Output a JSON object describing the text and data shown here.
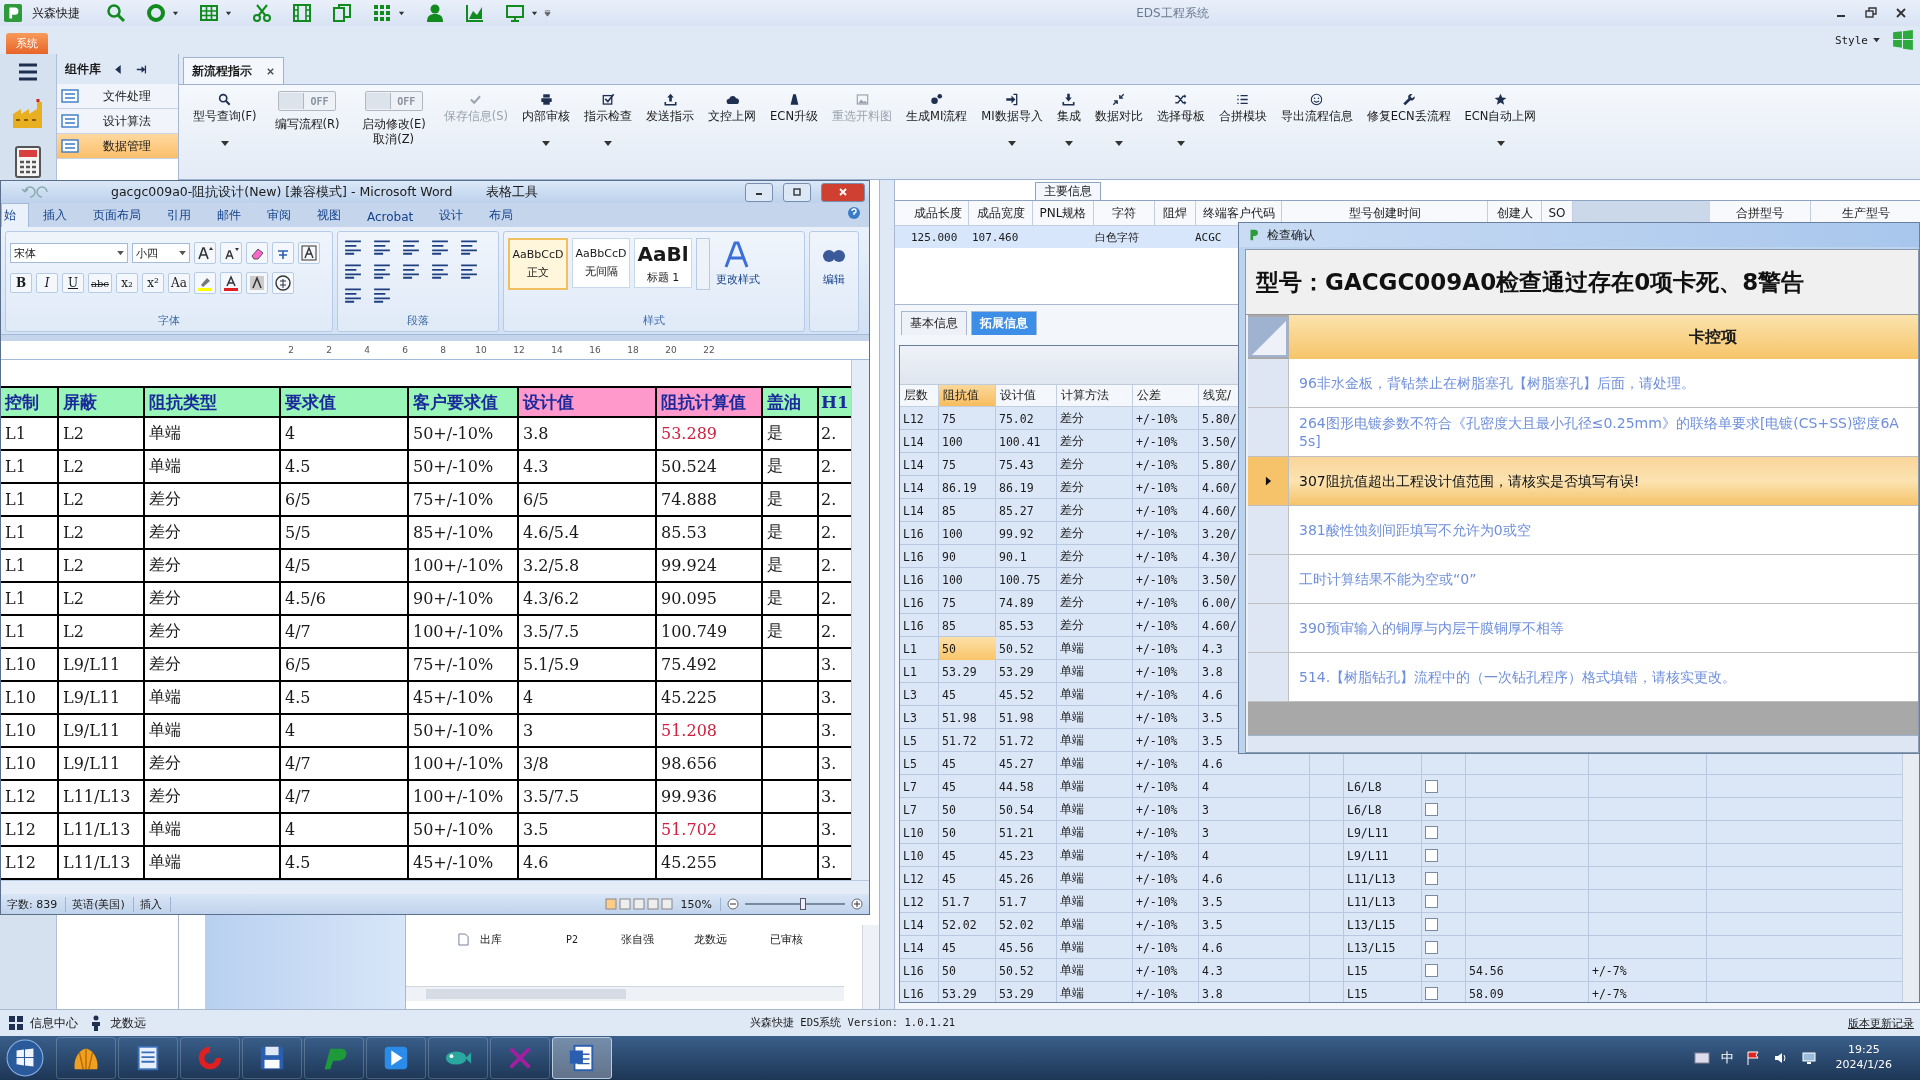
{
  "app": {
    "brand": "兴森快捷",
    "title": "EDS工程系统",
    "style_label": "Style"
  },
  "menu_tabs": [
    {
      "label": "系统",
      "selected": true
    }
  ],
  "sidebar": {
    "title": "组件库",
    "items": [
      {
        "label": "文件处理",
        "selected": false
      },
      {
        "label": "设计算法",
        "selected": false
      },
      {
        "label": "数据管理",
        "selected": true
      }
    ]
  },
  "doc_tabs": [
    {
      "label": "新流程指示",
      "selected": true
    }
  ],
  "toolbar": [
    {
      "kind": "button",
      "label": "型号查询(F)",
      "dropdown": true,
      "disabled": false
    },
    {
      "kind": "toggle",
      "label": "编写流程(R)",
      "switch_text": "OFF",
      "on": false
    },
    {
      "kind": "toggle",
      "label": "启动修改(E)\n取消(Z)",
      "switch_text": "OFF",
      "on": false
    },
    {
      "kind": "button",
      "label": "保存信息(S)",
      "dropdown": false,
      "disabled": true
    },
    {
      "kind": "button",
      "label": "内部审核",
      "dropdown": true,
      "disabled": false
    },
    {
      "kind": "button",
      "label": "指示检查",
      "dropdown": true,
      "disabled": false
    },
    {
      "kind": "button",
      "label": "发送指示",
      "dropdown": false,
      "disabled": false
    },
    {
      "kind": "button",
      "label": "文控上网",
      "dropdown": false,
      "disabled": false
    },
    {
      "kind": "button",
      "label": "ECN升级",
      "dropdown": false,
      "disabled": false
    },
    {
      "kind": "button",
      "label": "重选开料图",
      "dropdown": false,
      "disabled": true
    },
    {
      "kind": "button",
      "label": "生成MI流程",
      "dropdown": false,
      "disabled": false
    },
    {
      "kind": "button",
      "label": "MI数据导入",
      "dropdown": true,
      "disabled": false
    },
    {
      "kind": "button",
      "label": "集成",
      "dropdown": true,
      "disabled": false
    },
    {
      "kind": "button",
      "label": "数据对比",
      "dropdown": true,
      "disabled": false
    },
    {
      "kind": "button",
      "label": "选择母板",
      "dropdown": true,
      "disabled": false
    },
    {
      "kind": "button",
      "label": "合拼模块",
      "dropdown": false,
      "disabled": false
    },
    {
      "kind": "button",
      "label": "导出流程信息",
      "dropdown": false,
      "disabled": false
    },
    {
      "kind": "button",
      "label": "修复ECN丢流程",
      "dropdown": false,
      "disabled": false
    },
    {
      "kind": "button",
      "label": "ECN自动上网",
      "dropdown": true,
      "disabled": false
    }
  ],
  "info": {
    "legend": "主要信息",
    "columns": [
      {
        "label": "成品长度",
        "value": "125.000"
      },
      {
        "label": "成品宽度",
        "value": "107.460"
      },
      {
        "label": "PNL规格"
      },
      {
        "label": "字符",
        "value": "白色字符"
      },
      {
        "label": "阻焊"
      },
      {
        "label": "终端客户代码",
        "value": "ACGC"
      },
      {
        "label": "型号创建时间"
      },
      {
        "label": "创建人"
      },
      {
        "label": "SO"
      },
      {
        "kind": "blank"
      },
      {
        "label": "合拼型号"
      },
      {
        "label": "生产型号"
      }
    ]
  },
  "tabs": [
    {
      "label": "基本信息",
      "selected": false
    },
    {
      "label": "拓展信息",
      "selected": true
    }
  ],
  "grid": {
    "columns": [
      {
        "label": "层数",
        "selected": false
      },
      {
        "label": "阻抗值",
        "selected": true
      },
      {
        "label": "设计值",
        "selected": false
      },
      {
        "label": "计算方法",
        "selected": false
      },
      {
        "label": "公差",
        "selected": false
      },
      {
        "label": "线宽/",
        "selected": false
      }
    ],
    "rows": [
      {
        "cells": [
          "L12",
          "75",
          "75.02",
          "差分",
          "+/-10%",
          "5.80/"
        ],
        "selected": false
      },
      {
        "cells": [
          "L14",
          "100",
          "100.41",
          "差分",
          "+/-10%",
          "3.50/"
        ],
        "selected": false
      },
      {
        "cells": [
          "L14",
          "75",
          "75.43",
          "差分",
          "+/-10%",
          "5.80/"
        ],
        "selected": false
      },
      {
        "cells": [
          "L14",
          "86.19",
          "86.19",
          "差分",
          "+/-10%",
          "4.60/"
        ],
        "selected": false
      },
      {
        "cells": [
          "L14",
          "85",
          "85.27",
          "差分",
          "+/-10%",
          "4.60/"
        ],
        "selected": false
      },
      {
        "cells": [
          "L16",
          "100",
          "99.92",
          "差分",
          "+/-10%",
          "3.20/"
        ],
        "selected": false
      },
      {
        "cells": [
          "L16",
          "90",
          "90.1",
          "差分",
          "+/-10%",
          "4.30/"
        ],
        "selected": false
      },
      {
        "cells": [
          "L16",
          "100",
          "100.75",
          "差分",
          "+/-10%",
          "3.50/"
        ],
        "selected": false
      },
      {
        "cells": [
          "L16",
          "75",
          "74.89",
          "差分",
          "+/-10%",
          "6.00/"
        ],
        "selected": false
      },
      {
        "cells": [
          "L16",
          "85",
          "85.53",
          "差分",
          "+/-10%",
          "4.60/"
        ],
        "selected": false
      },
      {
        "cells": [
          "L1",
          "50",
          "50.52",
          "单端",
          "+/-10%",
          "4.3"
        ],
        "selected": true
      },
      {
        "cells": [
          "L1",
          "53.29",
          "53.29",
          "单端",
          "+/-10%",
          "3.8"
        ],
        "selected": false
      },
      {
        "cells": [
          "L3",
          "45",
          "45.52",
          "单端",
          "+/-10%",
          "4.6"
        ],
        "selected": false
      },
      {
        "cells": [
          "L3",
          "51.98",
          "51.98",
          "单端",
          "+/-10%",
          "3.5"
        ],
        "selected": false
      },
      {
        "cells": [
          "L5",
          "51.72",
          "51.72",
          "单端",
          "+/-10%",
          "3.5"
        ],
        "selected": false
      },
      {
        "cells": [
          "L5",
          "45",
          "45.27",
          "单端",
          "+/-10%",
          "4.6"
        ],
        "selected": false
      },
      {
        "cells": [
          "L7",
          "45",
          "44.58",
          "单端",
          "+/-10%",
          "4"
        ],
        "ref": "L6/L8",
        "checked": false,
        "selected": false
      },
      {
        "cells": [
          "L7",
          "50",
          "50.54",
          "单端",
          "+/-10%",
          "3"
        ],
        "ref": "L6/L8",
        "checked": false,
        "selected": false
      },
      {
        "cells": [
          "L10",
          "50",
          "51.21",
          "单端",
          "+/-10%",
          "3"
        ],
        "ref": "L9/L11",
        "checked": false,
        "selected": false
      },
      {
        "cells": [
          "L10",
          "45",
          "45.23",
          "单端",
          "+/-10%",
          "4"
        ],
        "ref": "L9/L11",
        "checked": false,
        "selected": false
      },
      {
        "cells": [
          "L12",
          "45",
          "45.26",
          "单端",
          "+/-10%",
          "4.6"
        ],
        "ref": "L11/L13",
        "checked": false,
        "selected": false
      },
      {
        "cells": [
          "L12",
          "51.7",
          "51.7",
          "单端",
          "+/-10%",
          "3.5"
        ],
        "ref": "L11/L13",
        "checked": false,
        "selected": false
      },
      {
        "cells": [
          "L14",
          "52.02",
          "52.02",
          "单端",
          "+/-10%",
          "3.5"
        ],
        "ref": "L13/L15",
        "checked": false,
        "selected": false
      },
      {
        "cells": [
          "L14",
          "45",
          "45.56",
          "单端",
          "+/-10%",
          "4.6"
        ],
        "ref": "L13/L15",
        "checked": false,
        "selected": false
      },
      {
        "cells": [
          "L16",
          "50",
          "50.52",
          "单端",
          "+/-10%",
          "4.3"
        ],
        "ref": "L15",
        "checked": false,
        "value": "54.56",
        "tolerance": "+/-7%",
        "selected": false
      },
      {
        "cells": [
          "L16",
          "53.29",
          "53.29",
          "单端",
          "+/-10%",
          "3.8"
        ],
        "ref": "L15",
        "checked": false,
        "value": "58.09",
        "tolerance": "+/-7%",
        "selected": false
      }
    ]
  },
  "tree_row": {
    "name": "出库",
    "code": "P2",
    "author": "张自强",
    "reviewer": "龙数远",
    "status": "已审核"
  },
  "status_bar": {
    "info_center": "信息中心",
    "user": "龙数远",
    "version": "兴森快捷 EDS系统 Version: 1.0.1.21",
    "link": "版本更新记录"
  },
  "word": {
    "title": "gacgc009a0-阻抗设计(New) [兼容模式] - Microsoft Word",
    "context_tab": "表格工具",
    "tabs": [
      {
        "label": "始",
        "selected": true
      },
      {
        "label": "插入",
        "selected": false
      },
      {
        "label": "页面布局",
        "selected": false
      },
      {
        "label": "引用",
        "selected": false
      },
      {
        "label": "邮件",
        "selected": false
      },
      {
        "label": "审阅",
        "selected": false
      },
      {
        "label": "视图",
        "selected": false
      },
      {
        "label": "Acrobat",
        "selected": false
      },
      {
        "label": "设计",
        "selected": false
      },
      {
        "label": "布局",
        "selected": false
      }
    ],
    "font": "宋体",
    "size": "小四",
    "format_buttons": [
      "B",
      "I",
      "U",
      "abc",
      "x₂",
      "x²",
      "Aa"
    ],
    "groups": [
      "字体",
      "段落",
      "样式"
    ],
    "styles": [
      {
        "sample": "AaBbCcD",
        "name": "正文",
        "selected": true
      },
      {
        "sample": "AaBbCcD",
        "name": "无间隔",
        "selected": false
      },
      {
        "sample": "AaBl",
        "name": "标题 1",
        "selected": false
      }
    ],
    "change_styles": "更改样式",
    "edit": "编辑",
    "ruler": [
      "2",
      "2",
      "4",
      "6",
      "8",
      "10",
      "12",
      "14",
      "16",
      "18",
      "20",
      "22"
    ],
    "table": {
      "columns": [
        {
          "label": "控制",
          "color": "#99f5b8"
        },
        {
          "label": "屏蔽",
          "color": "#99f5b8"
        },
        {
          "label": "阻抗类型",
          "color": "#99f5b8"
        },
        {
          "label": "要求值",
          "color": "#99f5b8"
        },
        {
          "label": "客户要求值",
          "color": "#99f5b8"
        },
        {
          "label": "设计值",
          "color": "#ff99cc"
        },
        {
          "label": "阻抗计算值",
          "color": "#ff99cc"
        },
        {
          "label": "盖油",
          "color": "#99f5b8"
        },
        {
          "label": "H1",
          "color": "#99f5b8"
        }
      ],
      "rows": [
        {
          "cells": [
            "L1",
            "L2",
            "单端",
            "4",
            "50+/-10%",
            "3.8",
            "53.289",
            "是",
            "2."
          ],
          "warn": true
        },
        {
          "cells": [
            "L1",
            "L2",
            "单端",
            "4.5",
            "50+/-10%",
            "4.3",
            "50.524",
            "是",
            "2."
          ],
          "warn": false
        },
        {
          "cells": [
            "L1",
            "L2",
            "差分",
            "6/5",
            "75+/-10%",
            "6/5",
            "74.888",
            "是",
            "2."
          ],
          "warn": false
        },
        {
          "cells": [
            "L1",
            "L2",
            "差分",
            "5/5",
            "85+/-10%",
            "4.6/5.4",
            "85.53",
            "是",
            "2."
          ],
          "warn": false
        },
        {
          "cells": [
            "L1",
            "L2",
            "差分",
            "4/5",
            "100+/-10%",
            "3.2/5.8",
            "99.924",
            "是",
            "2."
          ],
          "warn": false
        },
        {
          "cells": [
            "L1",
            "L2",
            "差分",
            "4.5/6",
            "90+/-10%",
            "4.3/6.2",
            "90.095",
            "是",
            "2."
          ],
          "warn": false
        },
        {
          "cells": [
            "L1",
            "L2",
            "差分",
            "4/7",
            "100+/-10%",
            "3.5/7.5",
            "100.749",
            "是",
            "2."
          ],
          "warn": false
        },
        {
          "cells": [
            "L10",
            "L9/L11",
            "差分",
            "6/5",
            "75+/-10%",
            "5.1/5.9",
            "75.492",
            null,
            "3."
          ],
          "warn": false
        },
        {
          "cells": [
            "L10",
            "L9/L11",
            "单端",
            "4.5",
            "45+/-10%",
            "4",
            "45.225",
            null,
            "3."
          ],
          "warn": false
        },
        {
          "cells": [
            "L10",
            "L9/L11",
            "单端",
            "4",
            "50+/-10%",
            "3",
            "51.208",
            null,
            "3."
          ],
          "warn": true
        },
        {
          "cells": [
            "L10",
            "L9/L11",
            "差分",
            "4/7",
            "100+/-10%",
            "3/8",
            "98.656",
            null,
            "3."
          ],
          "warn": false
        },
        {
          "cells": [
            "L12",
            "L11/L13",
            "差分",
            "4/7",
            "100+/-10%",
            "3.5/7.5",
            "99.936",
            null,
            "3."
          ],
          "warn": false
        },
        {
          "cells": [
            "L12",
            "L11/L13",
            "单端",
            "4",
            "50+/-10%",
            "3.5",
            "51.702",
            null,
            "3."
          ],
          "warn": true
        },
        {
          "cells": [
            "L12",
            "L11/L13",
            "单端",
            "4.5",
            "45+/-10%",
            "4.6",
            "45.255",
            null,
            "3."
          ],
          "warn": false
        }
      ]
    },
    "status": [
      "字数: 839",
      "英语(美国)",
      "插入"
    ],
    "zoom": {
      "label": "150%",
      "level": 0.58
    }
  },
  "dialog": {
    "title": "检查确认",
    "headline": "型号：GACGC009A0检查通过存在0项卡死、8警告",
    "column": "卡控项",
    "items": [
      {
        "text": "96非水金板，背钻禁止在树脂塞孔【树脂塞孔】后面，请处理。",
        "selected": false
      },
      {
        "text": "264图形电镀参数不符合《孔密度大且最小孔径≤0.25mm》的联络单要求[电镀(CS+SS)密度6A 5s]",
        "selected": false
      },
      {
        "text": "307阻抗值超出工程设计值范围，请核实是否填写有误!",
        "selected": true
      },
      {
        "text": "381酸性蚀刻间距填写不允许为0或空",
        "selected": false
      },
      {
        "text": "工时计算结果不能为空或“0”",
        "selected": false
      },
      {
        "text": "390预审输入的铜厚与内层干膜铜厚不相等",
        "selected": false
      },
      {
        "text": "514.【树脂钻孔】流程中的（一次钻孔程序）格式填错，请核实更改。",
        "selected": false
      }
    ]
  },
  "taskbar": {
    "apps": [
      {
        "selected": false
      },
      {
        "selected": false
      },
      {
        "selected": false
      },
      {
        "selected": false
      },
      {
        "selected": false
      },
      {
        "selected": false
      },
      {
        "selected": false
      },
      {
        "selected": false
      },
      {
        "selected": true
      }
    ],
    "ime": "中",
    "time": "19:25",
    "date": "2024/1/26"
  }
}
